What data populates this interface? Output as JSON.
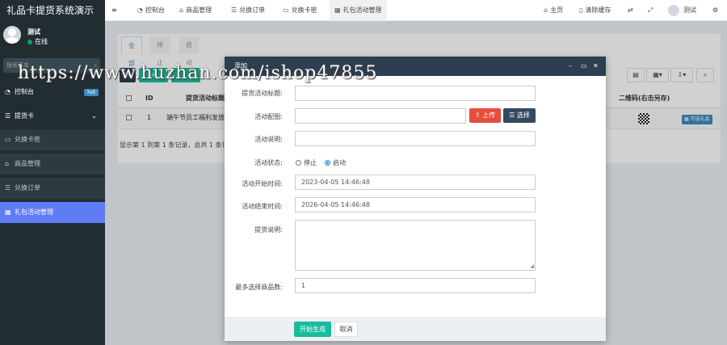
{
  "app": {
    "title": "礼品卡提货系统演示"
  },
  "user": {
    "name": "测试",
    "status": "在线"
  },
  "sidebar": {
    "search_placeholder": "搜索菜单",
    "items": [
      {
        "label": "控制台",
        "icon": "dashboard-icon",
        "badge": "hot"
      },
      {
        "label": "提货卡",
        "icon": "list-icon"
      },
      {
        "label": "兑换卡密",
        "icon": "card-icon"
      },
      {
        "label": "商品管理",
        "icon": "bank-icon"
      },
      {
        "label": "兑换订单",
        "icon": "list-icon"
      },
      {
        "label": "礼包活动管理",
        "icon": "grid-icon"
      }
    ]
  },
  "topnav": {
    "items": [
      {
        "label": "控制台",
        "icon": "dashboard-icon"
      },
      {
        "label": "商品管理",
        "icon": "bank-icon"
      },
      {
        "label": "兑换订单",
        "icon": "list-icon"
      },
      {
        "label": "兑换卡密",
        "icon": "card-icon"
      },
      {
        "label": "礼包活动管理",
        "icon": "grid-icon"
      }
    ],
    "home": "主页",
    "clear_cache": "清除缓存",
    "user": "测试"
  },
  "list": {
    "tabs": [
      "全部",
      "停止",
      "启动"
    ],
    "headers": {
      "id": "ID",
      "title": "提货活动标题",
      "qrcode": "二维码(右击另存)"
    },
    "rows": [
      {
        "id": "1",
        "title": "端午节员工福利发放",
        "action": "可选礼品"
      }
    ],
    "summary": "显示第 1 到第 1 条记录，总共 1 条记"
  },
  "modal": {
    "title": "添加",
    "fields": {
      "title_label": "提货活动标题:",
      "image_label": "活动配图:",
      "upload": "上传",
      "choose": "选择",
      "desc_label": "活动说明:",
      "status_label": "活动状态:",
      "status_stop": "停止",
      "status_start": "启动",
      "start_label": "活动开始时间:",
      "start_value": "2023-04-05 14:46:48",
      "end_label": "活动结束时间:",
      "end_value": "2026-04-05 14:46:48",
      "pickup_label": "提货说明:",
      "max_label": "最多选择商品数:",
      "max_value": "1"
    },
    "generate": "开始生成",
    "cancel": "取消"
  },
  "watermark": "https://www.huzhan.com/ishop47855"
}
